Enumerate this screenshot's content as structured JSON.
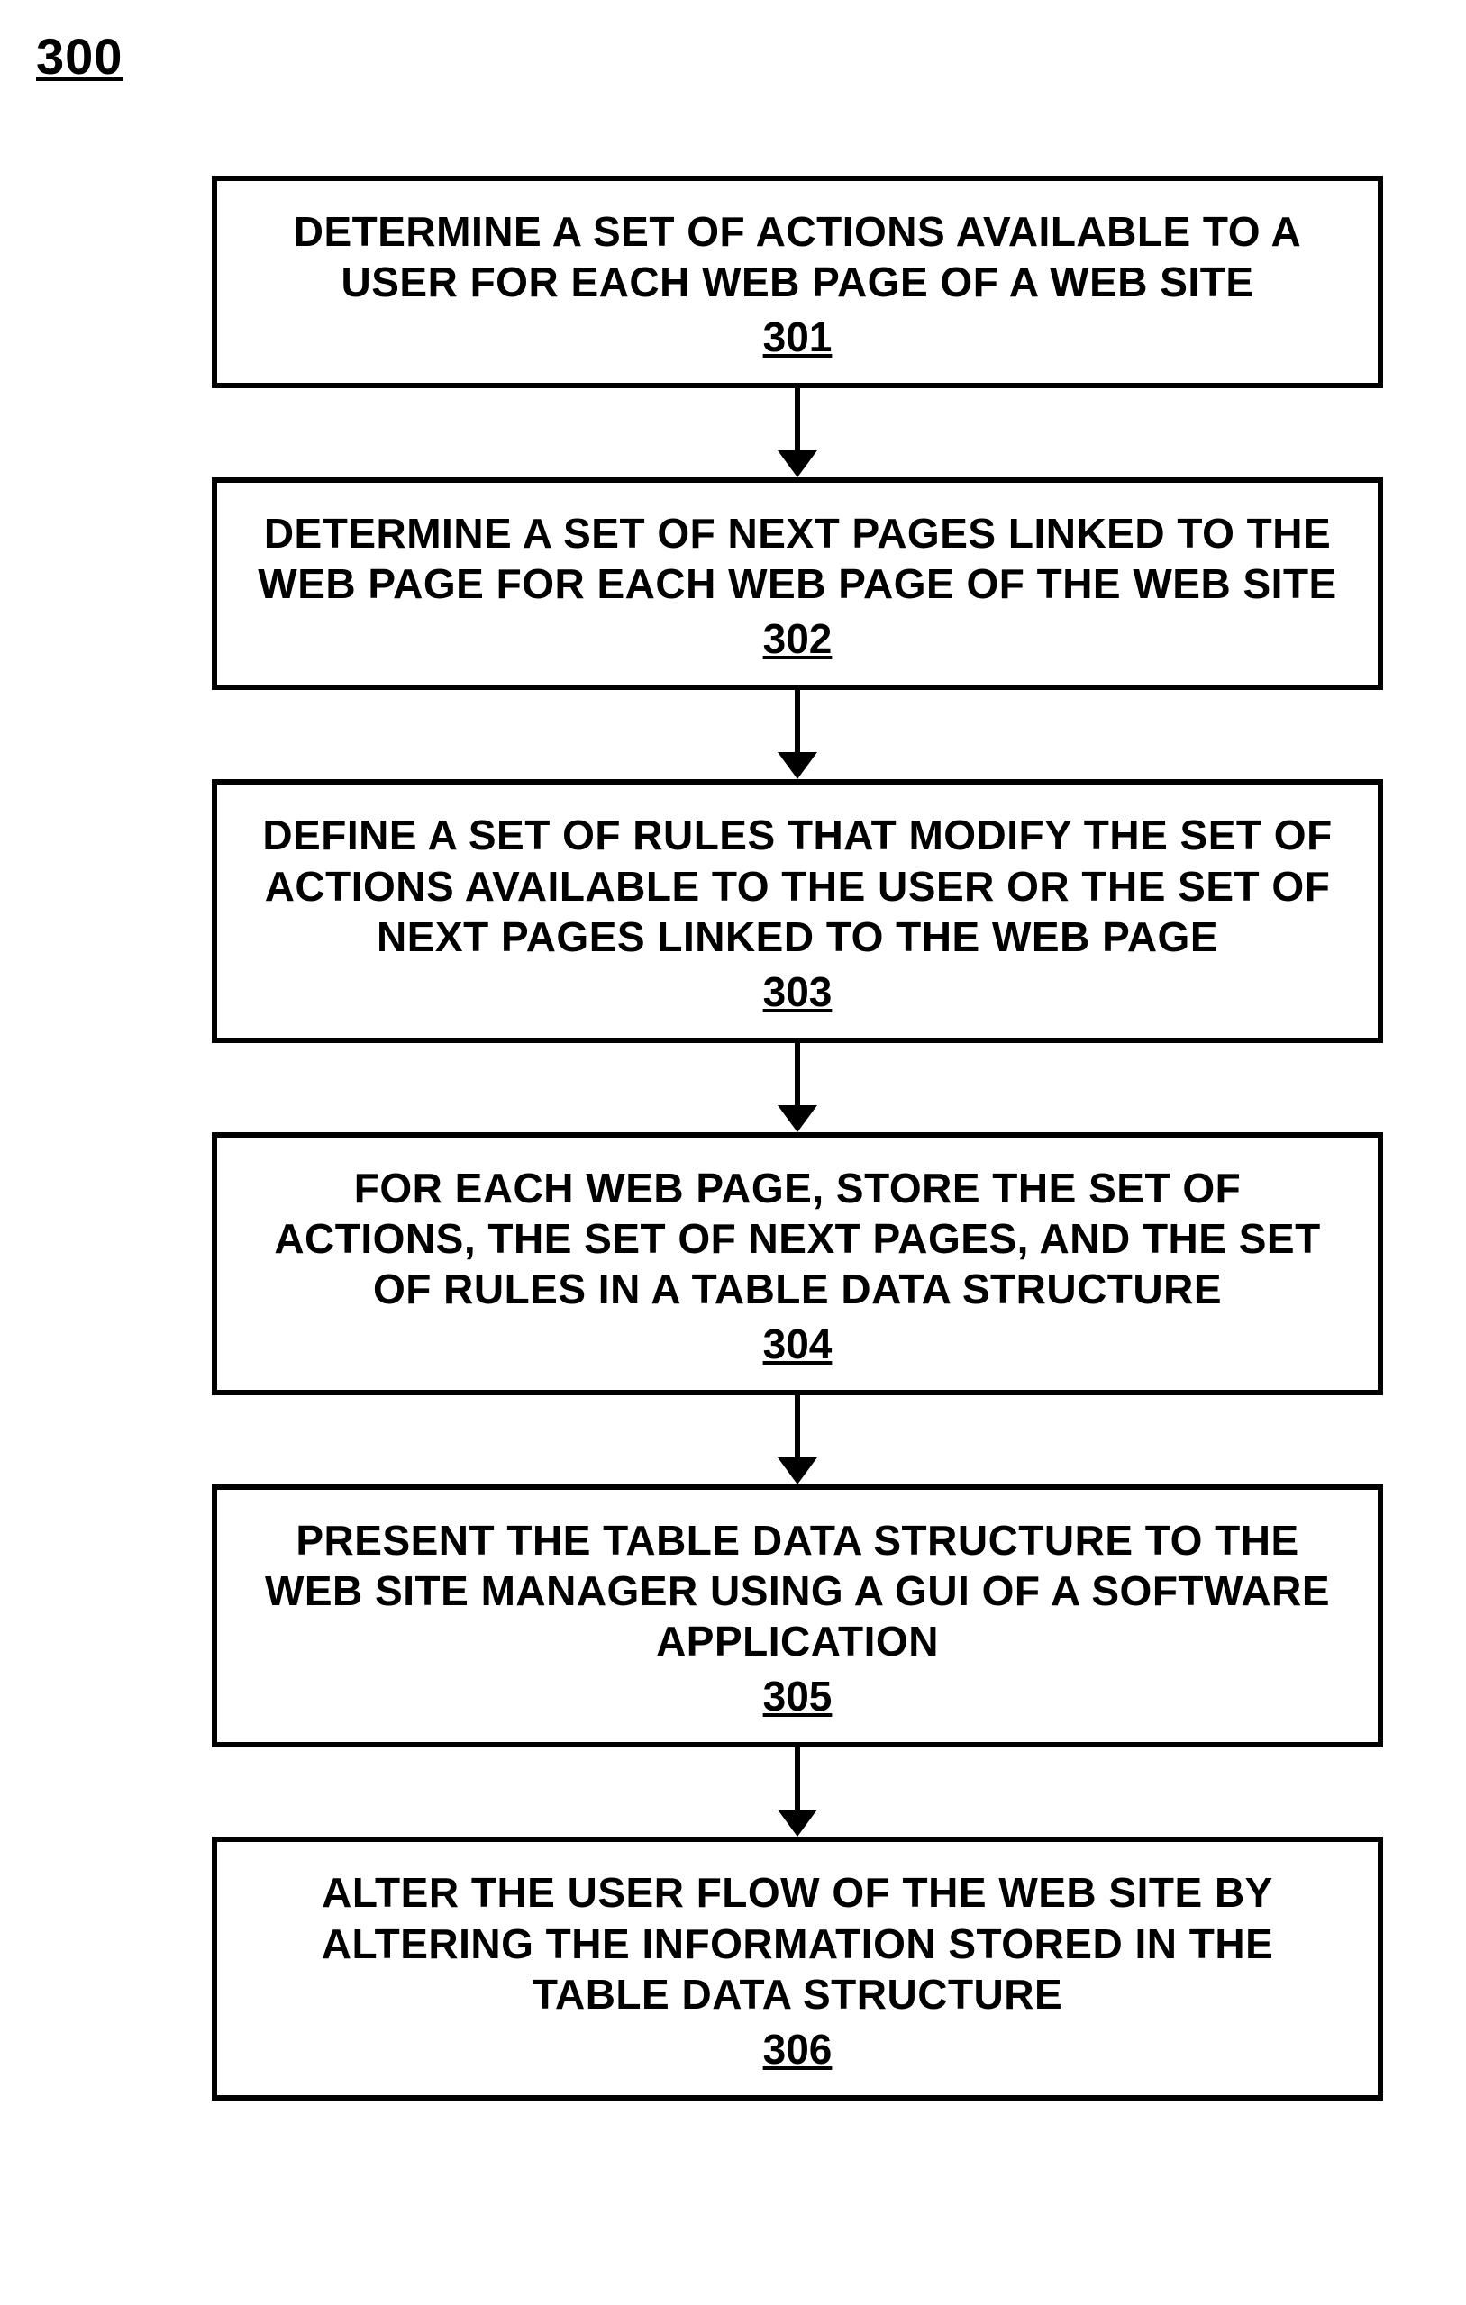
{
  "figure_number": "300",
  "steps": [
    {
      "text": "DETERMINE A SET OF ACTIONS AVAILABLE TO A USER FOR EACH WEB PAGE OF A WEB SITE",
      "num": "301"
    },
    {
      "text": "DETERMINE A SET OF NEXT PAGES LINKED TO THE WEB PAGE FOR EACH WEB PAGE OF THE WEB SITE",
      "num": "302"
    },
    {
      "text": "DEFINE A SET OF RULES THAT MODIFY THE SET OF ACTIONS AVAILABLE TO THE USER OR THE SET OF NEXT PAGES LINKED TO THE WEB PAGE",
      "num": "303"
    },
    {
      "text": "FOR EACH WEB PAGE, STORE THE SET OF ACTIONS, THE SET OF NEXT PAGES, AND THE SET OF RULES IN A TABLE DATA STRUCTURE",
      "num": "304"
    },
    {
      "text": "PRESENT THE TABLE DATA STRUCTURE TO THE WEB SITE MANAGER USING A GUI OF A SOFTWARE APPLICATION",
      "num": "305"
    },
    {
      "text": "ALTER THE USER FLOW OF THE WEB SITE BY ALTERING THE INFORMATION STORED IN THE TABLE DATA STRUCTURE",
      "num": "306"
    }
  ]
}
